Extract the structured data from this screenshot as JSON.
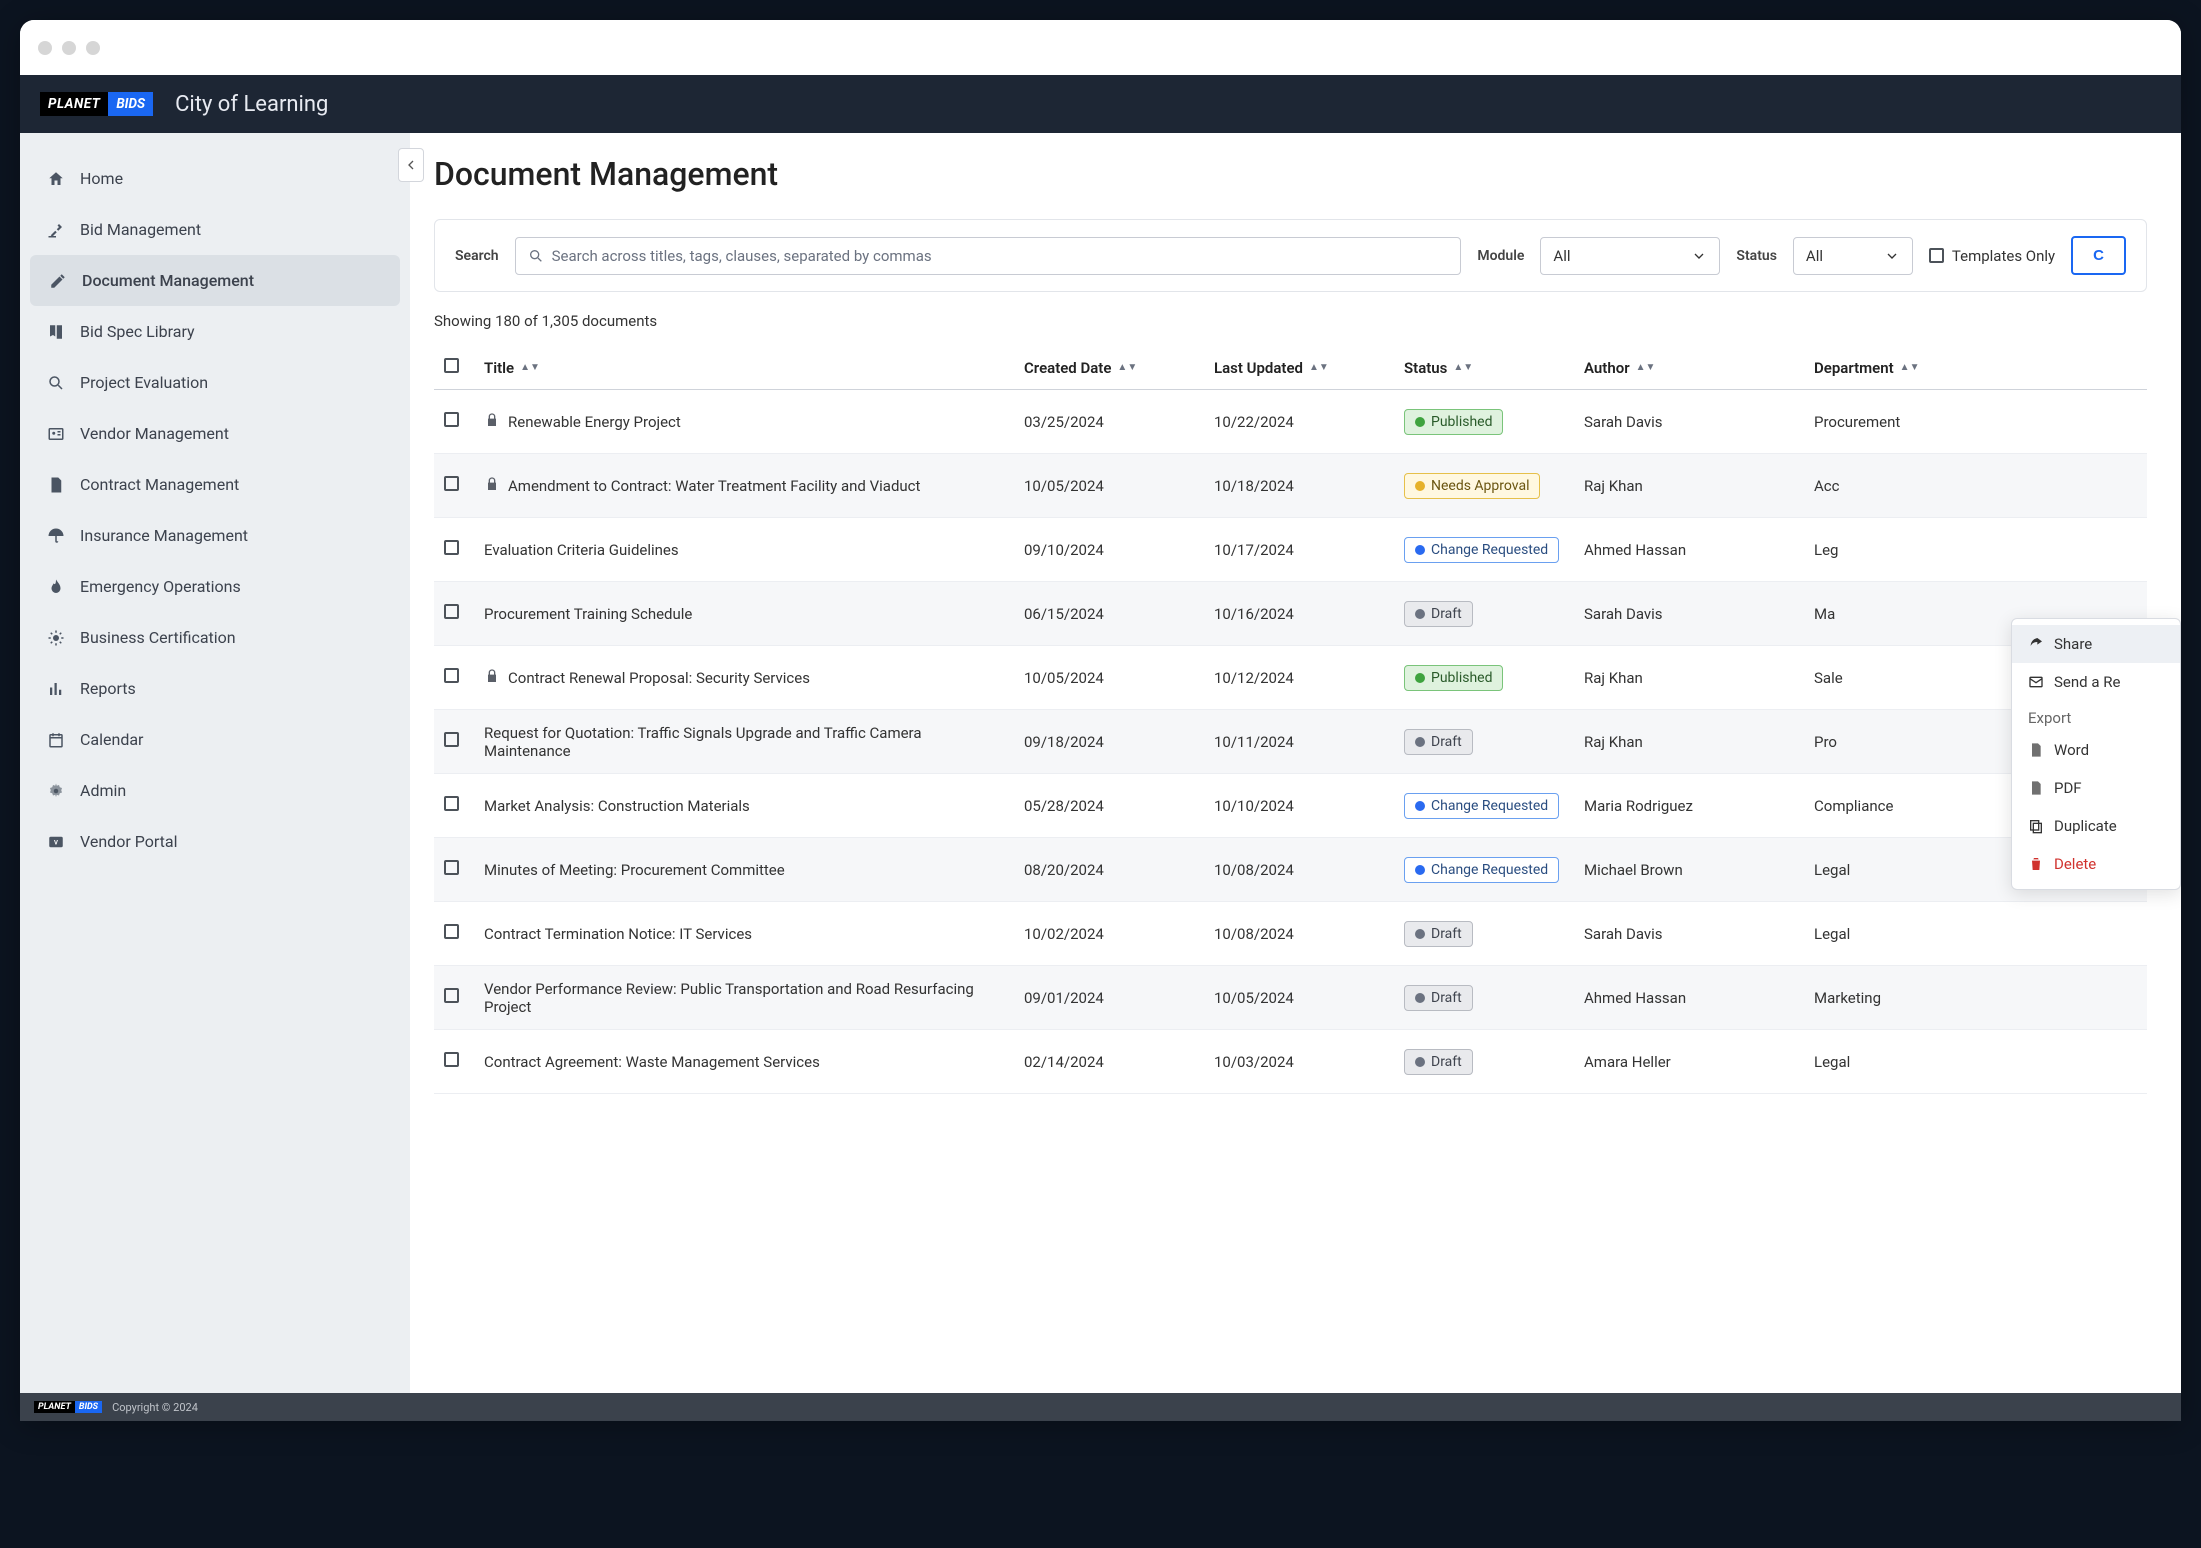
{
  "brand": {
    "planet": "PLANET",
    "bids": "BIDS"
  },
  "org": "City of Learning",
  "nav": [
    {
      "label": "Home",
      "icon": "home"
    },
    {
      "label": "Bid Management",
      "icon": "gavel"
    },
    {
      "label": "Document Management",
      "icon": "pen",
      "active": true
    },
    {
      "label": "Bid Spec Library",
      "icon": "book"
    },
    {
      "label": "Project Evaluation",
      "icon": "magnify"
    },
    {
      "label": "Vendor Management",
      "icon": "idcard"
    },
    {
      "label": "Contract Management",
      "icon": "file"
    },
    {
      "label": "Insurance Management",
      "icon": "umbrella"
    },
    {
      "label": "Emergency Operations",
      "icon": "flame"
    },
    {
      "label": "Business Certification",
      "icon": "sun"
    },
    {
      "label": "Reports",
      "icon": "bar"
    },
    {
      "label": "Calendar",
      "icon": "calendar"
    },
    {
      "label": "Admin",
      "icon": "gear"
    },
    {
      "label": "Vendor Portal",
      "icon": "portal"
    }
  ],
  "pageTitle": "Document Management",
  "filters": {
    "searchLabel": "Search",
    "searchPlaceholder": "Search across titles, tags, clauses, separated by commas",
    "moduleLabel": "Module",
    "moduleValue": "All",
    "statusLabel": "Status",
    "statusValue": "All",
    "templatesOnly": "Templates Only",
    "createBtn": "C"
  },
  "count": "Showing 180 of 1,305 documents",
  "columns": {
    "title": "Title",
    "created": "Created Date",
    "updated": "Last Updated",
    "status": "Status",
    "author": "Author",
    "dept": "Department"
  },
  "rows": [
    {
      "title": "Renewable Energy Project",
      "locked": true,
      "created": "03/25/2024",
      "updated": "10/22/2024",
      "status": "Published",
      "kind": "published",
      "author": "Sarah Davis",
      "dept": "Procurement"
    },
    {
      "title": "Amendment to Contract: Water Treatment Facility and Viaduct",
      "locked": true,
      "created": "10/05/2024",
      "updated": "10/18/2024",
      "status": "Needs Approval",
      "kind": "needs",
      "author": "Raj Khan",
      "dept": "Acc"
    },
    {
      "title": "Evaluation Criteria Guidelines",
      "created": "09/10/2024",
      "updated": "10/17/2024",
      "status": "Change Requested",
      "kind": "change",
      "author": "Ahmed Hassan",
      "dept": "Leg"
    },
    {
      "title": "Procurement Training Schedule",
      "created": "06/15/2024",
      "updated": "10/16/2024",
      "status": "Draft",
      "kind": "draft",
      "author": "Sarah Davis",
      "dept": "Ma"
    },
    {
      "title": "Contract Renewal Proposal: Security Services",
      "locked": true,
      "created": "10/05/2024",
      "updated": "10/12/2024",
      "status": "Published",
      "kind": "published",
      "author": "Raj Khan",
      "dept": "Sale"
    },
    {
      "title": "Request for Quotation: Traffic Signals Upgrade and Traffic Camera Maintenance",
      "created": "09/18/2024",
      "updated": "10/11/2024",
      "status": "Draft",
      "kind": "draft",
      "author": "Raj Khan",
      "dept": "Pro"
    },
    {
      "title": "Market Analysis: Construction Materials",
      "created": "05/28/2024",
      "updated": "10/10/2024",
      "status": "Change Requested",
      "kind": "change",
      "author": "Maria Rodriguez",
      "dept": "Compliance"
    },
    {
      "title": "Minutes of Meeting: Procurement Committee",
      "created": "08/20/2024",
      "updated": "10/08/2024",
      "status": "Change Requested",
      "kind": "change",
      "author": "Michael Brown",
      "dept": "Legal"
    },
    {
      "title": "Contract Termination Notice: IT Services",
      "created": "10/02/2024",
      "updated": "10/08/2024",
      "status": "Draft",
      "kind": "draft",
      "author": "Sarah Davis",
      "dept": "Legal"
    },
    {
      "title": "Vendor Performance Review: Public Transportation and Road Resurfacing Project",
      "created": "09/01/2024",
      "updated": "10/05/2024",
      "status": "Draft",
      "kind": "draft",
      "author": "Ahmed Hassan",
      "dept": "Marketing"
    },
    {
      "title": "Contract Agreement: Waste Management Services",
      "created": "02/14/2024",
      "updated": "10/03/2024",
      "status": "Draft",
      "kind": "draft",
      "author": "Amara Heller",
      "dept": "Legal"
    }
  ],
  "context": {
    "share": "Share",
    "send": "Send a Re",
    "exportHead": "Export",
    "word": "Word",
    "pdf": "PDF",
    "duplicate": "Duplicate",
    "delete": "Delete"
  },
  "copyright": "Copyright © 2024"
}
